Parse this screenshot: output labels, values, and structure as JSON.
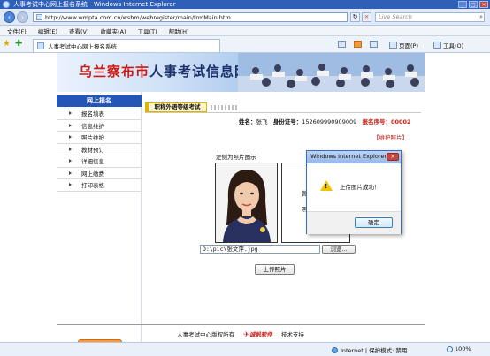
{
  "window": {
    "title": "人事考试中心网上报名系统 - Windows Internet Explorer"
  },
  "address": {
    "url": "http://www.wmpta.com.cn/wsbm/webregister/main/frmMain.htm",
    "search_placeholder": "Live Search"
  },
  "menubar": [
    "文件(F)",
    "编辑(E)",
    "查看(V)",
    "收藏夹(A)",
    "工具(T)",
    "帮助(H)"
  ],
  "tab": {
    "label": "人事考试中心网上报名系统"
  },
  "command_bar": {
    "page": "页面(P)",
    "tools": "工具(O)"
  },
  "banner": {
    "title_red": "乌兰察布市",
    "title_rest": "人事考试信息网"
  },
  "sidebar": {
    "header": "网上报名",
    "items": [
      "报名填表",
      "信息维护",
      "照片维护",
      "教材预订",
      "详细信息",
      "网上缴费",
      "打印表格"
    ],
    "back_button": "返回首页"
  },
  "main": {
    "exam_tab": "职称外语等级考试",
    "name_label": "姓名：",
    "name_value": "张飞",
    "id_label": "身份证号：",
    "id_value": "152609990909009",
    "seq_label": "报名序号：",
    "seq_value": "00002",
    "maintain_link": "【维护照片】",
    "photo_label": "左侧为照片图示",
    "uploaded_text_1": "暂",
    "uploaded_text_2": "照",
    "file_path": "D:\\pic\\张文萍.jpg",
    "browse_button": "浏览...",
    "upload_button": "上传照片"
  },
  "footer": {
    "copyright": "人事考试中心版权所有",
    "logo_text": "诚帆软件",
    "support": "技术支持"
  },
  "dialog": {
    "title": "Windows Internet Explorer",
    "message": "上传图片成功！",
    "ok_button": "确定"
  },
  "status": {
    "zone": "Internet | 保护模式: 禁用",
    "zoom": "100%"
  },
  "colors": {
    "title_bar": "#2f5fb7",
    "sidebar_header": "#2456b8",
    "accent_red": "#cc1a12",
    "back_button": "#ff9933"
  }
}
